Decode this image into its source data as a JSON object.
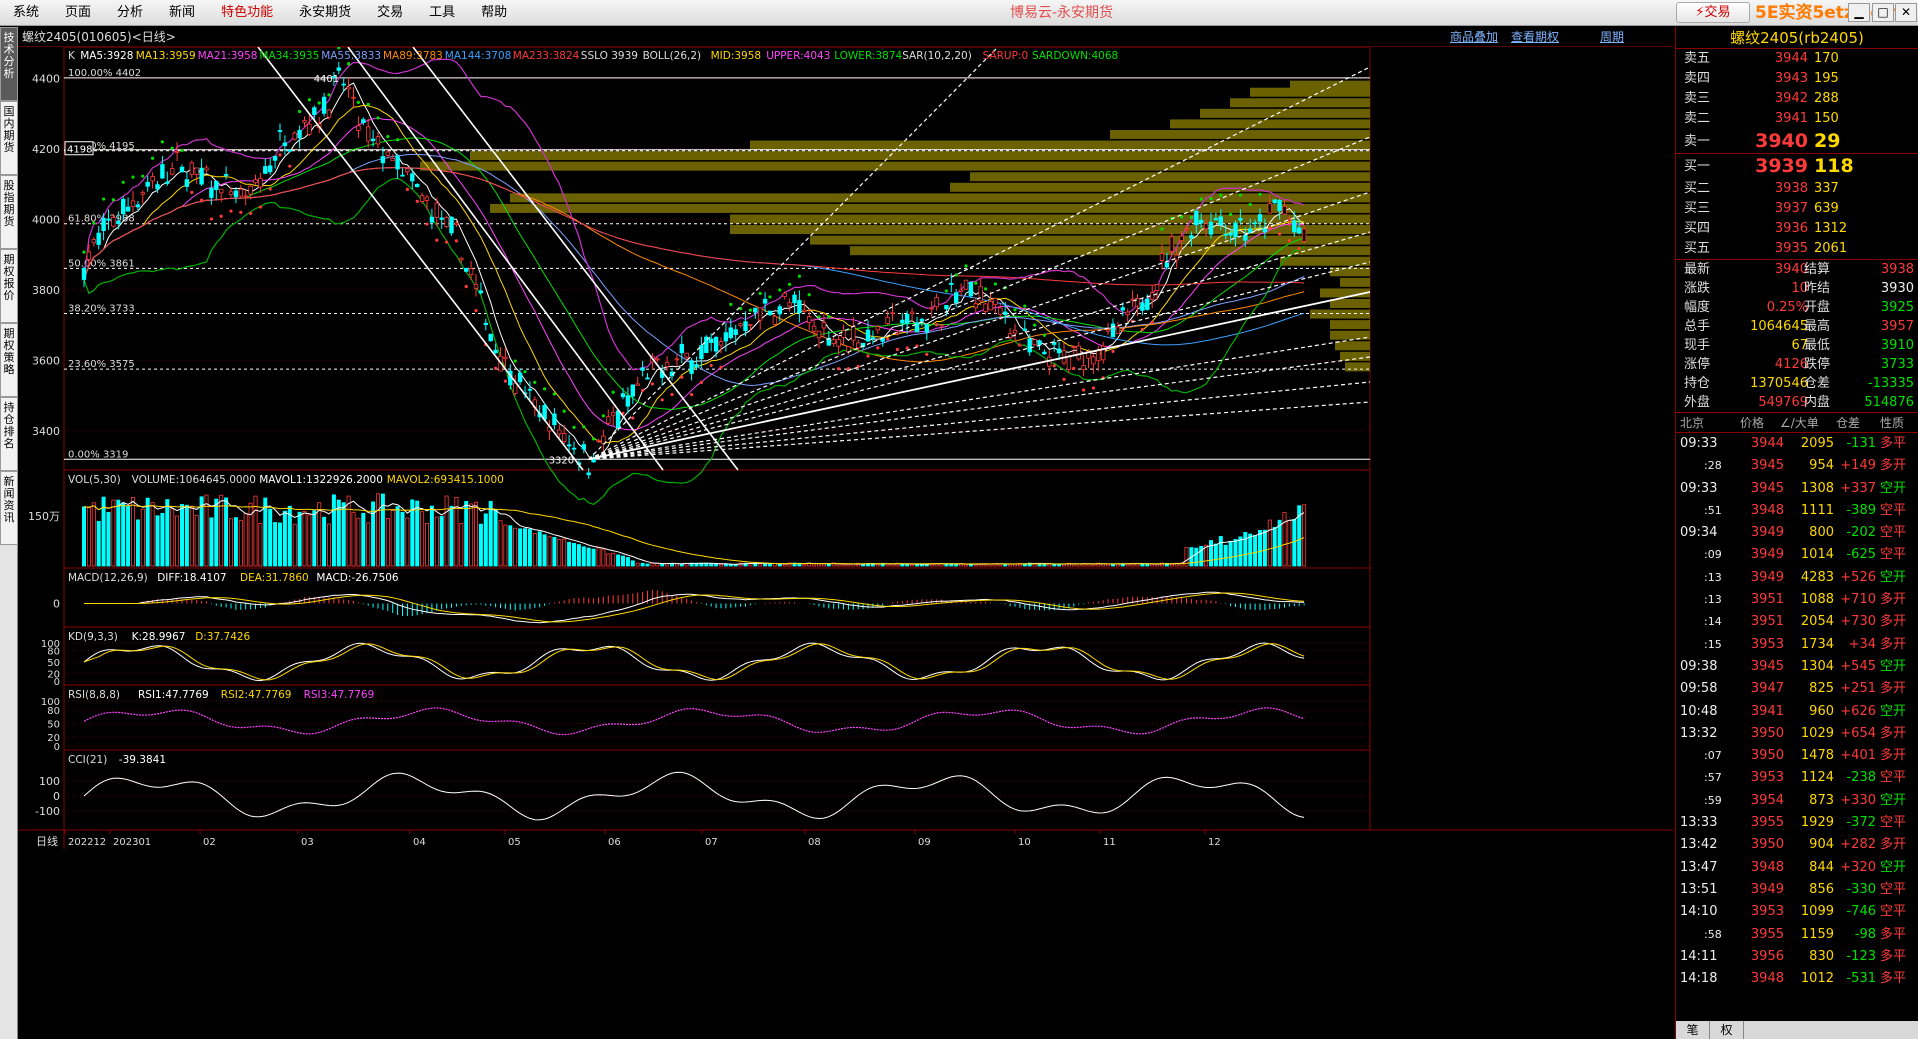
{
  "menu": {
    "items": [
      "系统",
      "页面",
      "分析",
      "新闻",
      "特色功能",
      "永安期货",
      "交易",
      "工具",
      "帮助"
    ],
    "hot_index": 4,
    "app_title": "博易云-永安期货",
    "trade_button": "⚡交易",
    "watermark": "5E实资5etz.com"
  },
  "left_tabs": [
    "技术分析",
    "国内期货",
    "股指期货",
    "期权报价",
    "期权策略",
    "持仓排名",
    "新闻资讯"
  ],
  "subheader": {
    "title": "螺纹2405(010605)<日线>",
    "links": [
      "商品叠加",
      "查看期权",
      "周期"
    ]
  },
  "main_indicator": {
    "items": [
      {
        "text": "K",
        "color": "#dddddd"
      },
      {
        "text": "MA5:3928",
        "color": "#ffffff"
      },
      {
        "text": "MA13:3959",
        "color": "#ffd800"
      },
      {
        "text": "MA21:3958",
        "color": "#ff44ff"
      },
      {
        "text": "MA34:3935",
        "color": "#00e000"
      },
      {
        "text": "MA55:3833",
        "color": "#7f9fff"
      },
      {
        "text": "MA89:3783",
        "color": "#ff8800"
      },
      {
        "text": "MA144:3708",
        "color": "#3aa0ff"
      },
      {
        "text": "MA233:3824",
        "color": "#ff3a3a"
      },
      {
        "text": "SSLO 3939",
        "color": "#dddddd"
      },
      {
        "text": "BOLL(26,2)",
        "color": "#dddddd"
      },
      {
        "text": "MID:3958",
        "color": "#ffd800"
      },
      {
        "text": "UPPER:4043",
        "color": "#ff44ff"
      },
      {
        "text": "LOWER:3874",
        "color": "#00e000"
      },
      {
        "text": "SAR(10,2,20)",
        "color": "#dddddd"
      },
      {
        "text": "SARUP:0",
        "color": "#ff3a3a"
      },
      {
        "text": "SARDOWN:4068",
        "color": "#00e000"
      }
    ]
  },
  "price_axis": {
    "labels": [
      "4400",
      "4200",
      "4000",
      "3800",
      "3600",
      "3400"
    ],
    "values": [
      4400,
      4200,
      4000,
      3800,
      3600,
      3400
    ],
    "min": 3300,
    "max": 4450
  },
  "fib_levels": [
    {
      "label": "100.00% 4402",
      "value": 4402
    },
    {
      "label": "80.90% 4195",
      "value": 4195
    },
    {
      "label": "61.80% 3988",
      "value": 3988
    },
    {
      "label": "50.00% 3861",
      "value": 3861
    },
    {
      "label": "38.20% 3733",
      "value": 3733
    },
    {
      "label": "23.60% 3575",
      "value": 3575
    },
    {
      "label": "0.00% 3319",
      "value": 3319
    }
  ],
  "cursor_price": {
    "label": "4198",
    "value": 4198
  },
  "peak_label": "4401",
  "low_label": "3320",
  "volume_panel": {
    "title": [
      {
        "text": "VOL(5,30)",
        "color": "#dddddd"
      },
      {
        "text": "VOLUME:1064645.0000",
        "color": "#dddddd"
      },
      {
        "text": "MAVOL1:1322926.2000",
        "color": "#ffffff"
      },
      {
        "text": "MAVOL2:693415.1000",
        "color": "#ffd800"
      }
    ],
    "axis_label": "150万"
  },
  "macd_panel": {
    "title": [
      {
        "text": "MACD(12,26,9)",
        "color": "#dddddd"
      },
      {
        "text": "DIFF:18.4107",
        "color": "#ffffff"
      },
      {
        "text": "DEA:31.7860",
        "color": "#ffd800"
      },
      {
        "text": "MACD:-26.7506",
        "color": "#ffffff"
      }
    ],
    "axis_labels": [
      "0"
    ]
  },
  "kd_panel": {
    "title": [
      {
        "text": "KD(9,3,3)",
        "color": "#dddddd"
      },
      {
        "text": "K:28.9967",
        "color": "#ffffff"
      },
      {
        "text": "D:37.7426",
        "color": "#ffd800"
      }
    ],
    "axis_labels": [
      "100",
      "80",
      "50",
      "20",
      "0"
    ]
  },
  "rsi_panel": {
    "title": [
      {
        "text": "RSI(8,8,8)",
        "color": "#dddddd"
      },
      {
        "text": "RSI1:47.7769",
        "color": "#ffffff"
      },
      {
        "text": "RSI2:47.7769",
        "color": "#ffd800"
      },
      {
        "text": "RSI3:47.7769",
        "color": "#ff44ff"
      }
    ],
    "axis_labels": [
      "100",
      "80",
      "50",
      "20",
      "0"
    ]
  },
  "cci_panel": {
    "title": [
      {
        "text": "CCI(21)",
        "color": "#dddddd"
      },
      {
        "text": "-39.3841",
        "color": "#ffffff"
      }
    ],
    "axis_labels": [
      "100",
      "0",
      "-100"
    ]
  },
  "time_axis": {
    "period_label": "日线",
    "labels": [
      "202212",
      "202301",
      "02",
      "03",
      "04",
      "05",
      "06",
      "07",
      "08",
      "09",
      "10",
      "11",
      "12"
    ]
  },
  "quote": {
    "title": "螺纹2405(rb2405)",
    "asks": [
      {
        "label": "卖五",
        "price": "3944",
        "vol": "170"
      },
      {
        "label": "卖四",
        "price": "3943",
        "vol": "195"
      },
      {
        "label": "卖三",
        "price": "3942",
        "vol": "288"
      },
      {
        "label": "卖二",
        "price": "3941",
        "vol": "150"
      },
      {
        "label": "卖一",
        "price": "3940",
        "vol": "29"
      }
    ],
    "bids": [
      {
        "label": "买一",
        "price": "3939",
        "vol": "118"
      },
      {
        "label": "买二",
        "price": "3938",
        "vol": "337"
      },
      {
        "label": "买三",
        "price": "3937",
        "vol": "639"
      },
      {
        "label": "买四",
        "price": "3936",
        "vol": "1312"
      },
      {
        "label": "买五",
        "price": "3935",
        "vol": "2061"
      }
    ],
    "stats": [
      {
        "l1": "最新",
        "v1": "3940",
        "c1": "red",
        "l2": "结算",
        "v2": "3938",
        "c2": "red"
      },
      {
        "l1": "涨跌",
        "v1": "10",
        "c1": "red",
        "l2": "昨结",
        "v2": "3930",
        "c2": "white"
      },
      {
        "l1": "幅度",
        "v1": "0.25%",
        "c1": "red",
        "l2": "开盘",
        "v2": "3925",
        "c2": "green"
      },
      {
        "l1": "总手",
        "v1": "1064645",
        "c1": "yellow",
        "l2": "最高",
        "v2": "3957",
        "c2": "red"
      },
      {
        "l1": "现手",
        "v1": "67",
        "c1": "yellow",
        "l2": "最低",
        "v2": "3910",
        "c2": "green"
      },
      {
        "l1": "涨停",
        "v1": "4126",
        "c1": "red",
        "l2": "跌停",
        "v2": "3733",
        "c2": "green"
      },
      {
        "l1": "持仓",
        "v1": "1370546",
        "c1": "yellow",
        "l2": "仓差",
        "v2": "-13335",
        "c2": "green"
      },
      {
        "l1": "外盘",
        "v1": "549769",
        "c1": "red",
        "l2": "内盘",
        "v2": "514876",
        "c2": "green"
      }
    ],
    "tick_header": [
      "北京",
      "价格",
      "∠/大单",
      "仓差",
      "性质"
    ],
    "ticks": [
      {
        "time": "09:33",
        "sub": false,
        "price": "3944",
        "vol": "2095",
        "oi": "-131",
        "oi_color": "green",
        "nature": "多平",
        "n_color": "red"
      },
      {
        "time": ":28",
        "sub": true,
        "price": "3945",
        "vol": "954",
        "oi": "+149",
        "oi_color": "red",
        "nature": "多开",
        "n_color": "red"
      },
      {
        "time": "09:33",
        "sub": false,
        "price": "3945",
        "vol": "1308",
        "oi": "+337",
        "oi_color": "red",
        "nature": "空开",
        "n_color": "green"
      },
      {
        "time": ":51",
        "sub": true,
        "price": "3948",
        "vol": "1111",
        "oi": "-389",
        "oi_color": "green",
        "nature": "空平",
        "n_color": "red"
      },
      {
        "time": "09:34",
        "sub": false,
        "price": "3949",
        "vol": "800",
        "oi": "-202",
        "oi_color": "green",
        "nature": "空平",
        "n_color": "red"
      },
      {
        "time": ":09",
        "sub": true,
        "price": "3949",
        "vol": "1014",
        "oi": "-625",
        "oi_color": "green",
        "nature": "空平",
        "n_color": "red"
      },
      {
        "time": ":13",
        "sub": true,
        "price": "3949",
        "vol": "4283",
        "oi": "+526",
        "oi_color": "red",
        "nature": "空开",
        "n_color": "green"
      },
      {
        "time": ":13",
        "sub": true,
        "price": "3951",
        "vol": "1088",
        "oi": "+710",
        "oi_color": "red",
        "nature": "多开",
        "n_color": "red"
      },
      {
        "time": ":14",
        "sub": true,
        "price": "3951",
        "vol": "2054",
        "oi": "+730",
        "oi_color": "red",
        "nature": "多开",
        "n_color": "red"
      },
      {
        "time": ":15",
        "sub": true,
        "price": "3953",
        "vol": "1734",
        "oi": "+34",
        "oi_color": "red",
        "nature": "多开",
        "n_color": "red"
      },
      {
        "time": "09:38",
        "sub": false,
        "price": "3945",
        "vol": "1304",
        "oi": "+545",
        "oi_color": "red",
        "nature": "空开",
        "n_color": "green"
      },
      {
        "time": "09:58",
        "sub": false,
        "price": "3947",
        "vol": "825",
        "oi": "+251",
        "oi_color": "red",
        "nature": "多开",
        "n_color": "red"
      },
      {
        "time": "10:48",
        "sub": false,
        "price": "3941",
        "vol": "960",
        "oi": "+626",
        "oi_color": "red",
        "nature": "空开",
        "n_color": "green"
      },
      {
        "time": "13:32",
        "sub": false,
        "price": "3950",
        "vol": "1029",
        "oi": "+654",
        "oi_color": "red",
        "nature": "多开",
        "n_color": "red"
      },
      {
        "time": ":07",
        "sub": true,
        "price": "3950",
        "vol": "1478",
        "oi": "+401",
        "oi_color": "red",
        "nature": "多开",
        "n_color": "red"
      },
      {
        "time": ":57",
        "sub": true,
        "price": "3953",
        "vol": "1124",
        "oi": "-238",
        "oi_color": "green",
        "nature": "空平",
        "n_color": "red"
      },
      {
        "time": ":59",
        "sub": true,
        "price": "3954",
        "vol": "873",
        "oi": "+330",
        "oi_color": "red",
        "nature": "空开",
        "n_color": "green"
      },
      {
        "time": "13:33",
        "sub": false,
        "price": "3955",
        "vol": "1929",
        "oi": "-372",
        "oi_color": "green",
        "nature": "空平",
        "n_color": "red"
      },
      {
        "time": "13:42",
        "sub": false,
        "price": "3950",
        "vol": "904",
        "oi": "+282",
        "oi_color": "red",
        "nature": "多开",
        "n_color": "red"
      },
      {
        "time": "13:47",
        "sub": false,
        "price": "3948",
        "vol": "844",
        "oi": "+320",
        "oi_color": "red",
        "nature": "空开",
        "n_color": "green"
      },
      {
        "time": "13:51",
        "sub": false,
        "price": "3949",
        "vol": "856",
        "oi": "-330",
        "oi_color": "green",
        "nature": "空平",
        "n_color": "red"
      },
      {
        "time": "14:10",
        "sub": false,
        "price": "3953",
        "vol": "1099",
        "oi": "-746",
        "oi_color": "green",
        "nature": "空平",
        "n_color": "red"
      },
      {
        "time": ":58",
        "sub": true,
        "price": "3955",
        "vol": "1159",
        "oi": "-98",
        "oi_color": "green",
        "nature": "多平",
        "n_color": "red"
      },
      {
        "time": "14:11",
        "sub": false,
        "price": "3956",
        "vol": "830",
        "oi": "-123",
        "oi_color": "green",
        "nature": "多平",
        "n_color": "red"
      },
      {
        "time": "14:18",
        "sub": false,
        "price": "3948",
        "vol": "1012",
        "oi": "-531",
        "oi_color": "green",
        "nature": "多平",
        "n_color": "red"
      }
    ],
    "bottom_tabs": [
      "笔",
      "权"
    ]
  }
}
